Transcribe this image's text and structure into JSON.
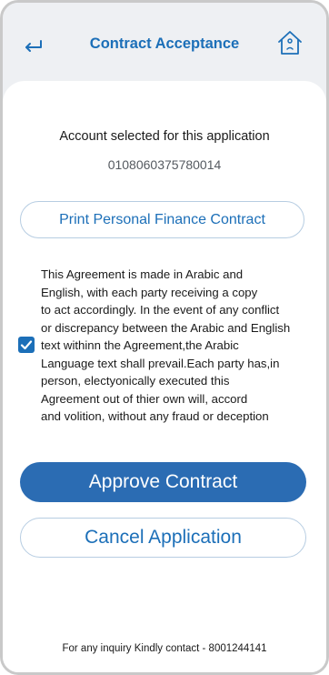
{
  "header": {
    "title": "Contract Acceptance",
    "back_icon": "back-arrow-icon",
    "home_icon": "home-icon"
  },
  "account": {
    "label": "Account selected for this application",
    "number": "0108060375780014"
  },
  "print_button_label": "Print Personal Finance Contract",
  "agreement": {
    "checked": true,
    "lines": [
      "This Agreement is made in Arabic and",
      "English, with each party receiving a copy",
      "to act accordingly. In the event of any conflict",
      "or discrepancy between the Arabic and English",
      "text withinn the Agreement,the Arabic",
      "Language text shall prevail.Each party has,in",
      "person, electyonically executed this",
      "Agreement out of thier own will, accord",
      "and volition, without any fraud or deception"
    ]
  },
  "approve_button_label": "Approve Contract",
  "cancel_button_label": "Cancel Application",
  "footer_text": "For any inquiry Kindly contact - 8001244141",
  "colors": {
    "accent": "#1c6fb8",
    "primary_button": "#2b6cb3",
    "header_bg": "#eef0f3"
  }
}
